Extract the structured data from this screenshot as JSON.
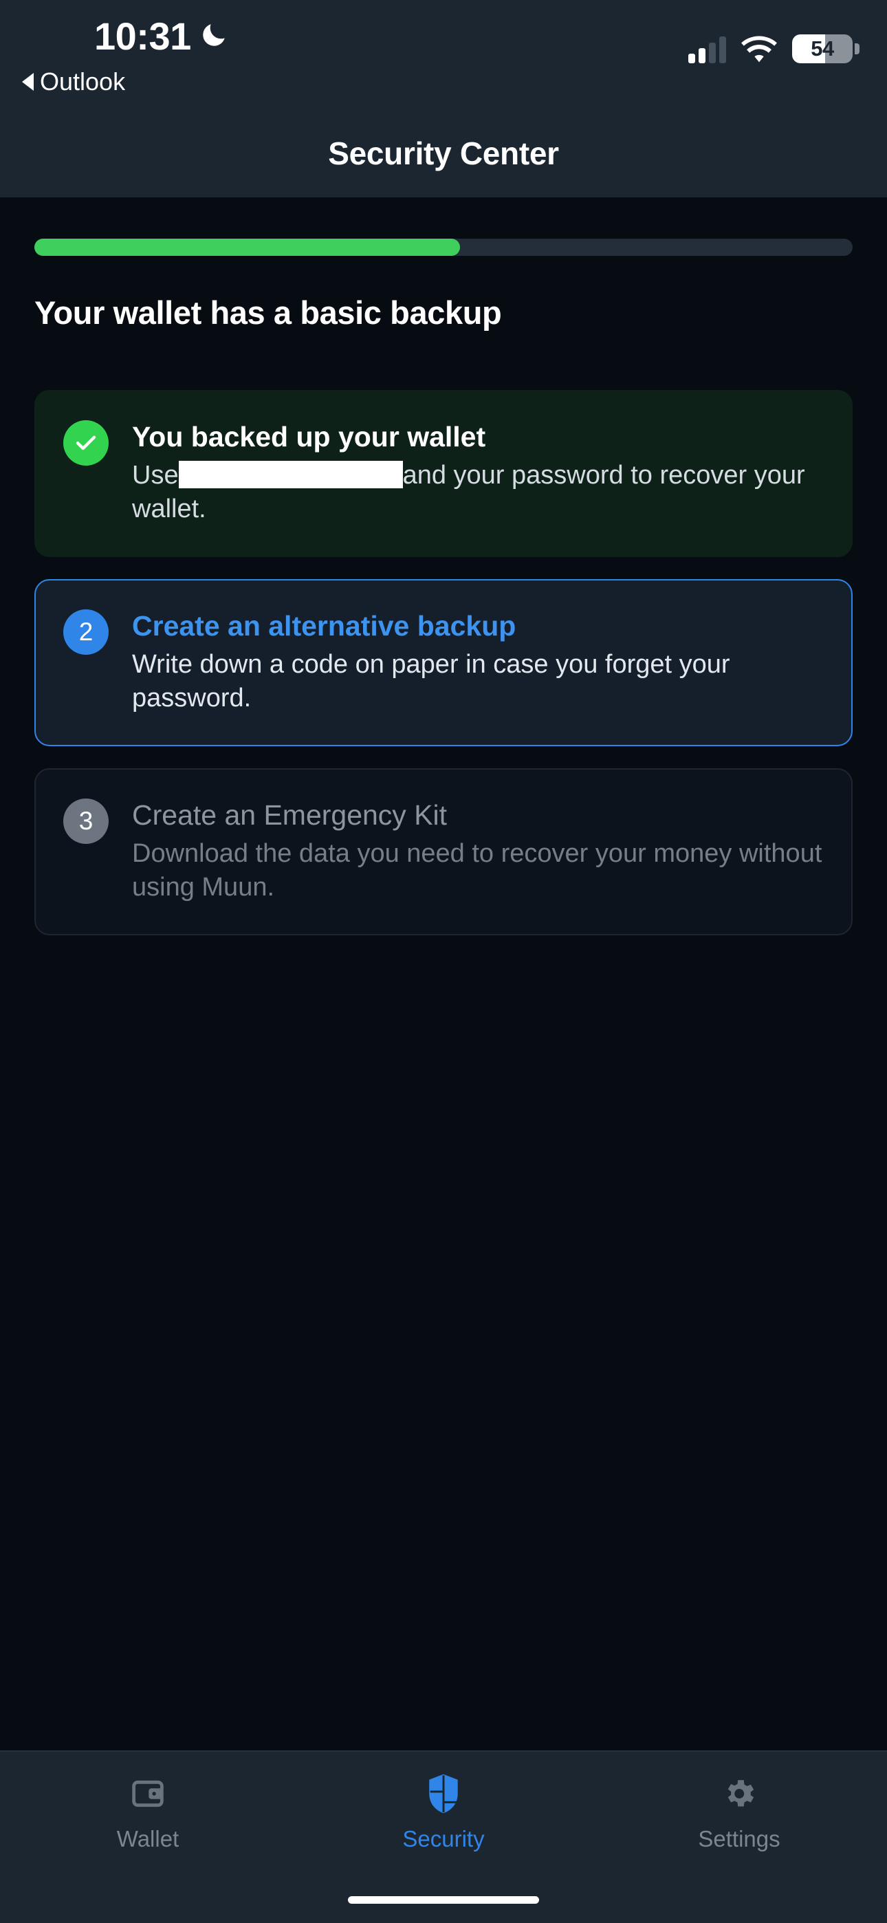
{
  "status_bar": {
    "time": "10:31",
    "dnd_icon": "crescent-moon-icon",
    "back_app_label": "Outlook",
    "back_icon": "back-triangle-icon",
    "cellular": {
      "icon": "cellular-signal-icon",
      "bars_total": 4,
      "bars_filled": 2
    },
    "wifi": {
      "icon": "wifi-icon",
      "strength": "full"
    },
    "battery": {
      "icon": "battery-icon",
      "percent_label": "54",
      "percent": 54
    }
  },
  "header": {
    "title": "Security Center"
  },
  "progress": {
    "percent": 52,
    "fill_color": "#3ecf5c",
    "track_color": "#232e3a"
  },
  "main": {
    "section_title": "Your wallet has a basic backup",
    "steps": [
      {
        "state": "done",
        "badge": "check-icon",
        "badge_label": "",
        "title": "You backed up your wallet",
        "desc_before": "Use",
        "desc_redacted": true,
        "desc_after": "and your password to recover your wallet."
      },
      {
        "state": "active",
        "badge": "step-number",
        "badge_label": "2",
        "title": "Create an alternative backup",
        "desc": "Write down a code on paper in case you forget your password."
      },
      {
        "state": "todo",
        "badge": "step-number",
        "badge_label": "3",
        "title": "Create an Emergency Kit",
        "desc": "Download the data you need to recover your money without using Muun."
      }
    ]
  },
  "tabbar": {
    "tabs": [
      {
        "label": "Wallet",
        "icon": "wallet-icon",
        "active": false
      },
      {
        "label": "Security",
        "icon": "shield-icon",
        "active": true
      },
      {
        "label": "Settings",
        "icon": "gear-icon",
        "active": false
      }
    ],
    "active_color": "#2f86e8",
    "inactive_color": "#7d8690"
  }
}
